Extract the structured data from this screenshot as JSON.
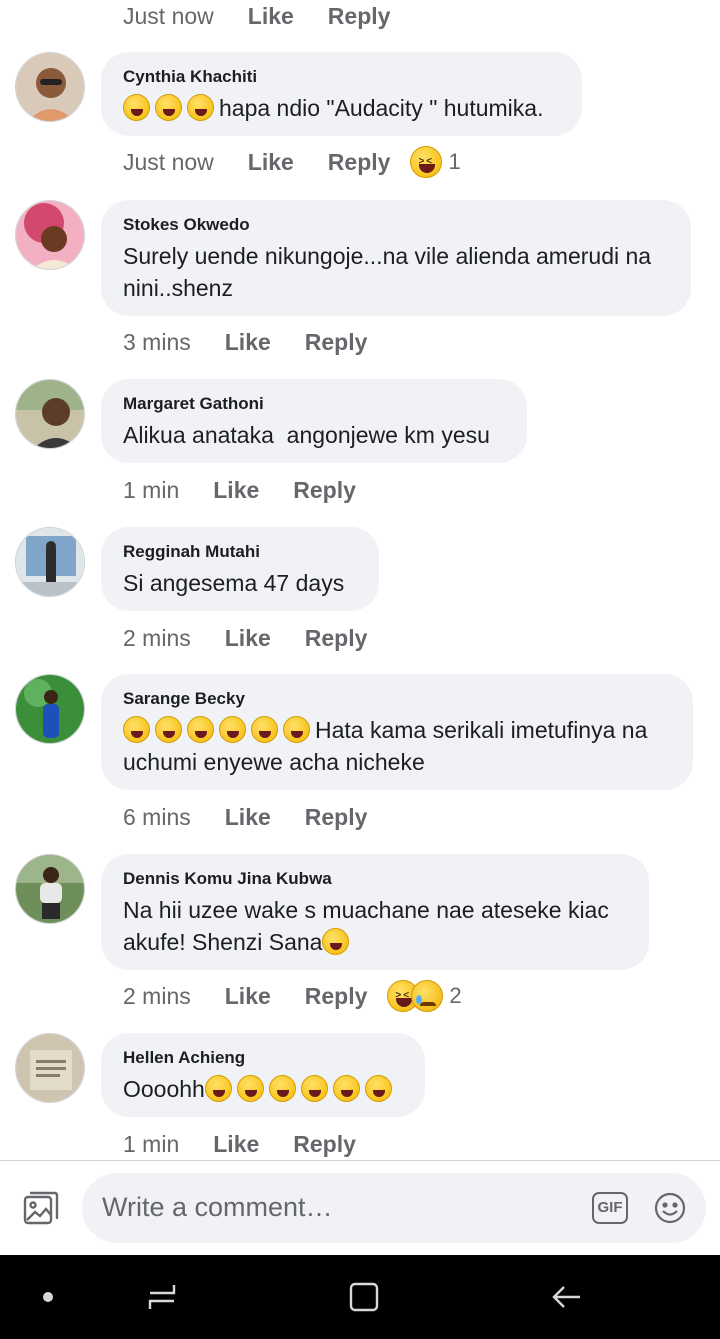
{
  "top_actions": {
    "time": "Just now",
    "like": "Like",
    "reply": "Reply"
  },
  "comments": [
    {
      "author": "Cynthia Khachiti",
      "text": "hapa ndio \"Audacity \" hutumika.",
      "leading_emoji_count": 3,
      "time": "Just now",
      "like": "Like",
      "reply": "Reply",
      "reactions": [
        "laughing-face"
      ],
      "reaction_count": "1",
      "avatar_colors": [
        "#d9c9b8",
        "#8a5a3a"
      ]
    },
    {
      "author": "Stokes Okwedo",
      "text": "Surely uende nikungoje...na vile alienda amerudi na nini..shenz",
      "time": "3 mins",
      "like": "Like",
      "reply": "Reply",
      "avatar_colors": [
        "#d2486e",
        "#f3b0c2"
      ]
    },
    {
      "author": "Margaret Gathoni",
      "text": "Alikua anataka  angonjewe km yesu",
      "time": "1 min",
      "like": "Like",
      "reply": "Reply",
      "avatar_colors": [
        "#c8c2a8",
        "#5b3d2a"
      ]
    },
    {
      "author": "Regginah Mutahi",
      "text": "Si angesema 47 days",
      "time": "2 mins",
      "like": "Like",
      "reply": "Reply",
      "avatar_colors": [
        "#dfe6ea",
        "#2c2c2c"
      ]
    },
    {
      "author": "Sarange Becky",
      "text": "Hata kama serikali imetufinya na uchumi enyewe acha nicheke",
      "leading_emoji_count": 6,
      "time": "6 mins",
      "like": "Like",
      "reply": "Reply",
      "avatar_colors": [
        "#3b8f3b",
        "#1f4fb8"
      ]
    },
    {
      "author": "Dennis Komu Jina Kubwa",
      "text": "Na hii uzee wake s muachane nae ateseke kiac akufe! Shenzi Sana",
      "trailing_emoji_count": 1,
      "time": "2 mins",
      "like": "Like",
      "reply": "Reply",
      "reactions": [
        "laughing-face",
        "sad-face"
      ],
      "reaction_count": "2",
      "avatar_colors": [
        "#6f8f5a",
        "#e8e8e8"
      ]
    },
    {
      "author": "Hellen Achieng",
      "text": "Oooohh",
      "trailing_emoji_count": 6,
      "time": "1 min",
      "like": "Like",
      "reply": "Reply",
      "avatar_colors": [
        "#cfc4b0",
        "#8a7d68"
      ]
    }
  ],
  "composer": {
    "placeholder": "Write a comment…",
    "gif_label": "GIF",
    "photo_icon": "photo-icon",
    "emoji_icon": "smiley-icon"
  },
  "navbar": {
    "icons": [
      "dot-icon",
      "recent-apps-icon",
      "home-icon",
      "back-icon"
    ]
  },
  "colors": {
    "bubble": "#f0f2f5",
    "secondary_text": "#65676b",
    "primary_text": "#1c1e21",
    "navbar": "#000000"
  }
}
